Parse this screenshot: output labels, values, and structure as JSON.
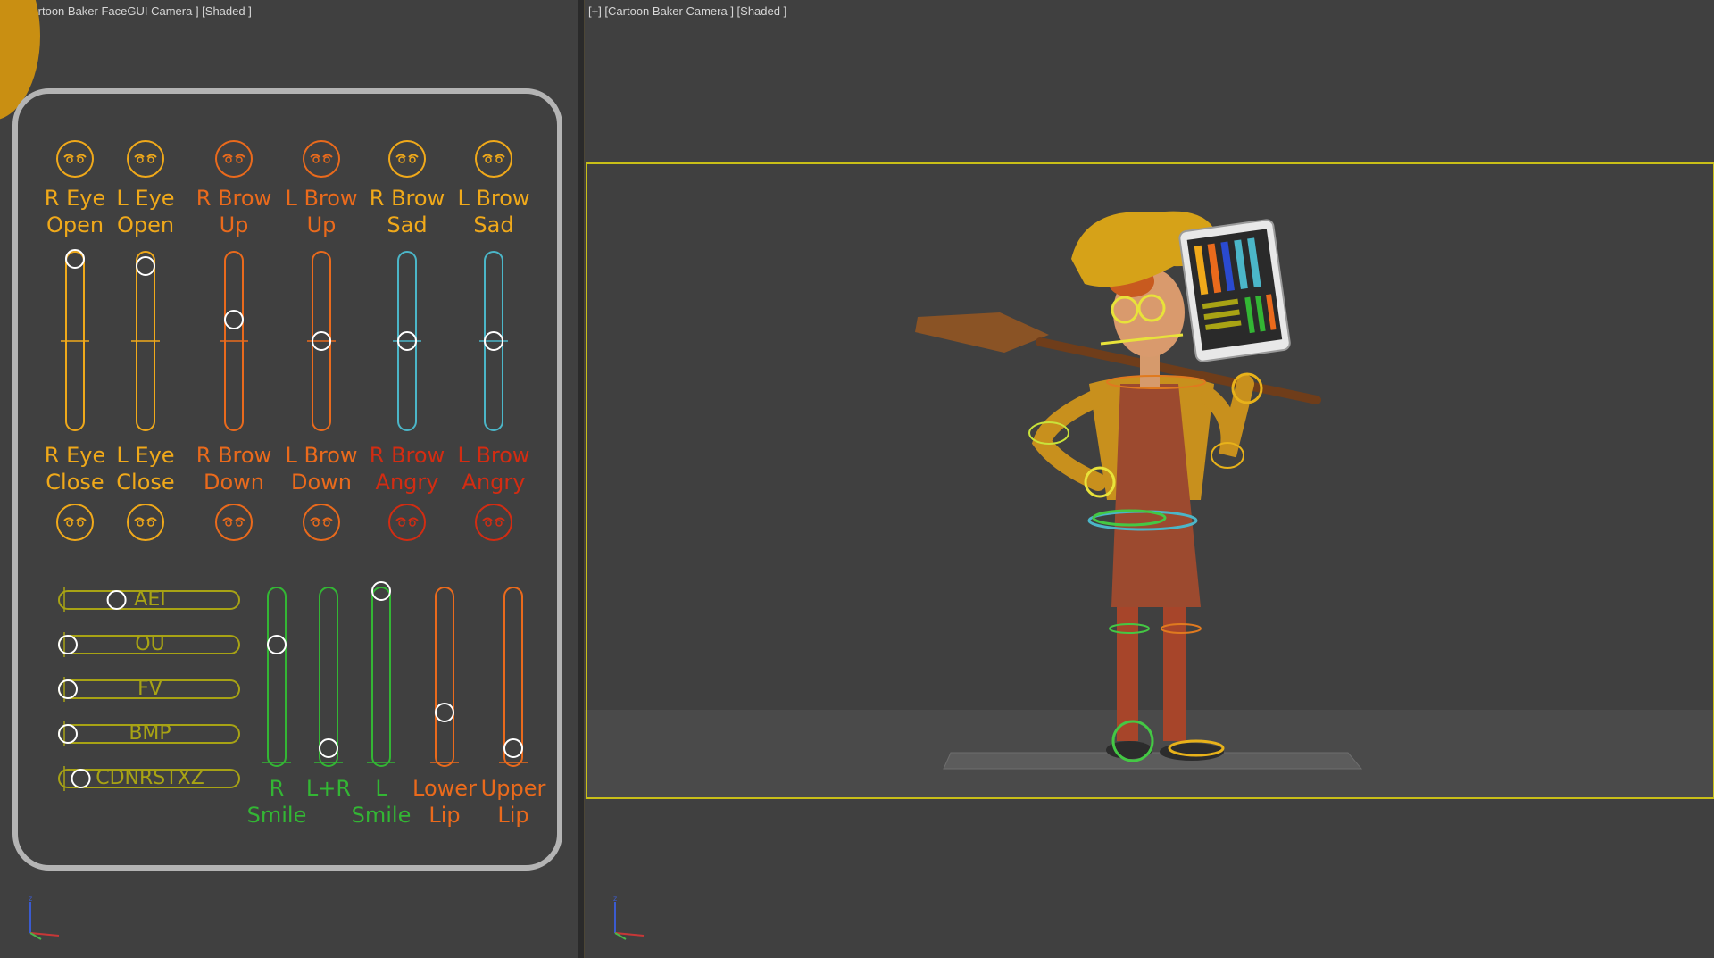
{
  "viewports": {
    "left": {
      "label": "[+] [Cartoon Baker FaceGUI Camera ] [Shaded ]"
    },
    "right": {
      "label": "[+] [Cartoon Baker Camera ] [Shaded ]"
    }
  },
  "face_gui": {
    "top_labels": [
      {
        "text": "R Eye\nOpen",
        "color": "#f0a91a"
      },
      {
        "text": "L Eye\nOpen",
        "color": "#f0a91a"
      },
      {
        "text": "R Brow\nUp",
        "color": "#ea6a1c"
      },
      {
        "text": "L Brow\nUp",
        "color": "#ea6a1c"
      },
      {
        "text": "R Brow\nSad",
        "color": "#f0a91a"
      },
      {
        "text": "L Brow\nSad",
        "color": "#f0a91a"
      }
    ],
    "bottom_labels": [
      {
        "text": "R Eye\nClose",
        "color": "#f0a91a"
      },
      {
        "text": "L Eye\nClose",
        "color": "#f0a91a"
      },
      {
        "text": "R Brow\nDown",
        "color": "#ea6a1c"
      },
      {
        "text": "L Brow\nDown",
        "color": "#ea6a1c"
      },
      {
        "text": "R Brow\nAngry",
        "color": "#d32c12"
      },
      {
        "text": "L Brow\nAngry",
        "color": "#d32c12"
      }
    ],
    "vertical_sliders_top": [
      {
        "name": "r-eye",
        "value": 0.96,
        "color": "#f0a91a"
      },
      {
        "name": "l-eye",
        "value": 0.92,
        "color": "#f0a91a"
      },
      {
        "name": "r-brow-updown",
        "value": 0.62,
        "color": "#ea6a1c"
      },
      {
        "name": "l-brow-updown",
        "value": 0.5,
        "color": "#ea6a1c"
      },
      {
        "name": "r-brow-sadangry",
        "value": 0.5,
        "color": "#4bb6c8"
      },
      {
        "name": "l-brow-sadangry",
        "value": 0.5,
        "color": "#4bb6c8"
      }
    ],
    "phonemes": [
      {
        "label": "AEI",
        "value": 0.3
      },
      {
        "label": "OU",
        "value": 0.0
      },
      {
        "label": "FV",
        "value": 0.0
      },
      {
        "label": "BMP",
        "value": 0.0
      },
      {
        "label": "CDNRSTXZ",
        "value": 0.08
      }
    ],
    "mouth_labels": [
      {
        "text": "R\nSmile",
        "color": "#33b634"
      },
      {
        "text": "L+R",
        "color": "#33b634"
      },
      {
        "text": "L\nSmile",
        "color": "#33b634"
      },
      {
        "text": "Lower\nLip",
        "color": "#ea6a1c"
      },
      {
        "text": "Upper\nLip",
        "color": "#ea6a1c"
      }
    ],
    "mouth_sliders": [
      {
        "name": "r-smile",
        "value": 0.68,
        "color": "#33b634"
      },
      {
        "name": "l-r-smile",
        "value": 0.1,
        "color": "#33b634"
      },
      {
        "name": "l-smile",
        "value": 0.98,
        "color": "#33b634"
      },
      {
        "name": "lower-lip",
        "value": 0.3,
        "color": "#ea6a1c"
      },
      {
        "name": "upper-lip",
        "value": 0.1,
        "color": "#ea6a1c"
      }
    ]
  }
}
